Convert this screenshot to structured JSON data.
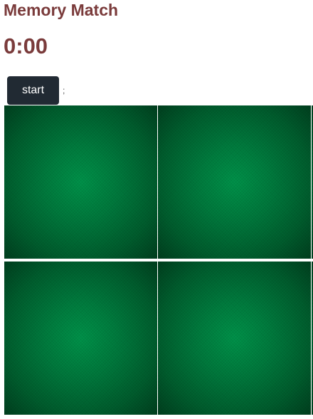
{
  "app": {
    "title": "Memory Match"
  },
  "timer": {
    "display": "0:00"
  },
  "controls": {
    "start_label": "start",
    "status_text": ";"
  },
  "board": {
    "card_back_color": "#007a3d",
    "cards": [
      {
        "state": "face-down"
      },
      {
        "state": "face-down"
      },
      {
        "state": "face-down"
      },
      {
        "state": "face-down"
      },
      {
        "state": "face-down"
      },
      {
        "state": "face-down"
      }
    ]
  },
  "colors": {
    "heading": "#7a3b3b",
    "button_bg": "#212a33",
    "button_text": "#ffffff"
  }
}
